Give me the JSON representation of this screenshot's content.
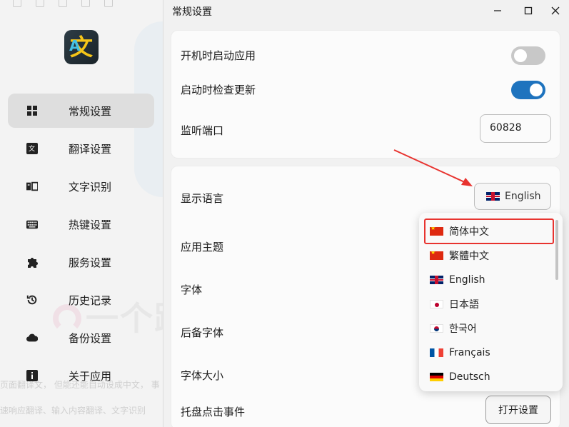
{
  "sidebar": {
    "items": [
      {
        "label": "常规设置",
        "icon": "grid-icon",
        "active": true
      },
      {
        "label": "翻译设置",
        "icon": "translate-icon",
        "active": false
      },
      {
        "label": "文字识别",
        "icon": "ocr-icon",
        "active": false
      },
      {
        "label": "热键设置",
        "icon": "keyboard-icon",
        "active": false
      },
      {
        "label": "服务设置",
        "icon": "puzzle-icon",
        "active": false
      },
      {
        "label": "历史记录",
        "icon": "history-icon",
        "active": false
      },
      {
        "label": "备份设置",
        "icon": "cloud-icon",
        "active": false
      },
      {
        "label": "关于应用",
        "icon": "info-icon",
        "active": false
      }
    ]
  },
  "background": {
    "watermark": "一个跨",
    "line1": "页面翻译文，  但能还能自动设成中文，  事",
    "line2": "速响应翻译、输入内容翻译、文字识别"
  },
  "window": {
    "title": "常规设置",
    "card1": {
      "launch_on_startup": {
        "label": "开机时启动应用",
        "enabled": false
      },
      "check_update": {
        "label": "启动时检查更新",
        "enabled": true
      },
      "port": {
        "label": "监听端口",
        "value": "60828"
      }
    },
    "card2": {
      "language": {
        "label": "显示语言",
        "selected": "English"
      },
      "theme": {
        "label": "应用主题"
      },
      "font": {
        "label": "字体"
      },
      "fallback_font": {
        "label": "后备字体"
      },
      "font_size": {
        "label": "字体大小"
      },
      "tray_click": {
        "label": "托盘点击事件",
        "button": "打开设置"
      }
    }
  },
  "language_dropdown": {
    "options": [
      {
        "label": "简体中文",
        "flag": "cn",
        "highlighted": true
      },
      {
        "label": "繁體中文",
        "flag": "cn",
        "highlighted": false
      },
      {
        "label": "English",
        "flag": "gb",
        "highlighted": false
      },
      {
        "label": "日本語",
        "flag": "jp",
        "highlighted": false
      },
      {
        "label": "한국어",
        "flag": "kr",
        "highlighted": false
      },
      {
        "label": "Français",
        "flag": "fr",
        "highlighted": false
      },
      {
        "label": "Deutsch",
        "flag": "de",
        "highlighted": false
      }
    ]
  },
  "colors": {
    "accent": "#1e73be",
    "highlight_box": "#e8332f",
    "annotation_arrow": "#e8332f"
  }
}
